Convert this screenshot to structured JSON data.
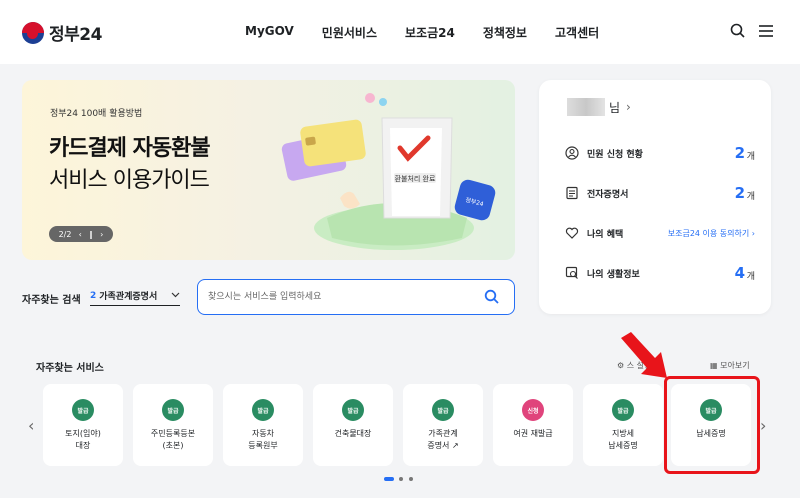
{
  "header": {
    "logo_text": "정부24",
    "nav": [
      "MyGOV",
      "민원서비스",
      "보조금24",
      "정책정보",
      "고객센터"
    ]
  },
  "banner": {
    "subtitle": "정부24 100배 활용방법",
    "title_line1": "카드결제 자동환불",
    "title_line2": "서비스 이용가이드",
    "pager": "2/2",
    "receipt_text": "환불처리 완료",
    "badge_text": "정부24"
  },
  "user_card": {
    "name_suffix": "님",
    "rows": [
      {
        "label": "민원 신청 현황",
        "count": "2",
        "unit": "개"
      },
      {
        "label": "전자증명서",
        "count": "2",
        "unit": "개"
      },
      {
        "label": "나의 혜택",
        "link": "보조금24 이용 동의하기"
      },
      {
        "label": "나의 생활정보",
        "count": "4",
        "unit": "개"
      }
    ]
  },
  "search": {
    "label": "자주찾는 검색",
    "select_num": "2",
    "select_value": "가족관계증명서",
    "placeholder": "찾으시는 서비스를 입력하세요"
  },
  "frequent": {
    "title": "자주찾는 서비스",
    "setting_label": "스 설정",
    "viewall_label": "모아보기",
    "items": [
      {
        "badge": "발급",
        "label": "토지(임야)\n대장"
      },
      {
        "badge": "발급",
        "label": "주민등록등본\n(초본)"
      },
      {
        "badge": "발급",
        "label": "자동차\n등록원부"
      },
      {
        "badge": "발급",
        "label": "건축물대장"
      },
      {
        "badge": "발급",
        "label": "가족관계\n증명서"
      },
      {
        "badge": "신청",
        "label": "여권 재발급"
      },
      {
        "badge": "발급",
        "label": "지방세\n납세증명"
      },
      {
        "badge": "발급",
        "label": "납세증명"
      }
    ]
  },
  "colors": {
    "accent": "#256ef4",
    "badge_green": "#2a8c62",
    "badge_pink": "#e0447c",
    "highlight_red": "#e8141a"
  }
}
